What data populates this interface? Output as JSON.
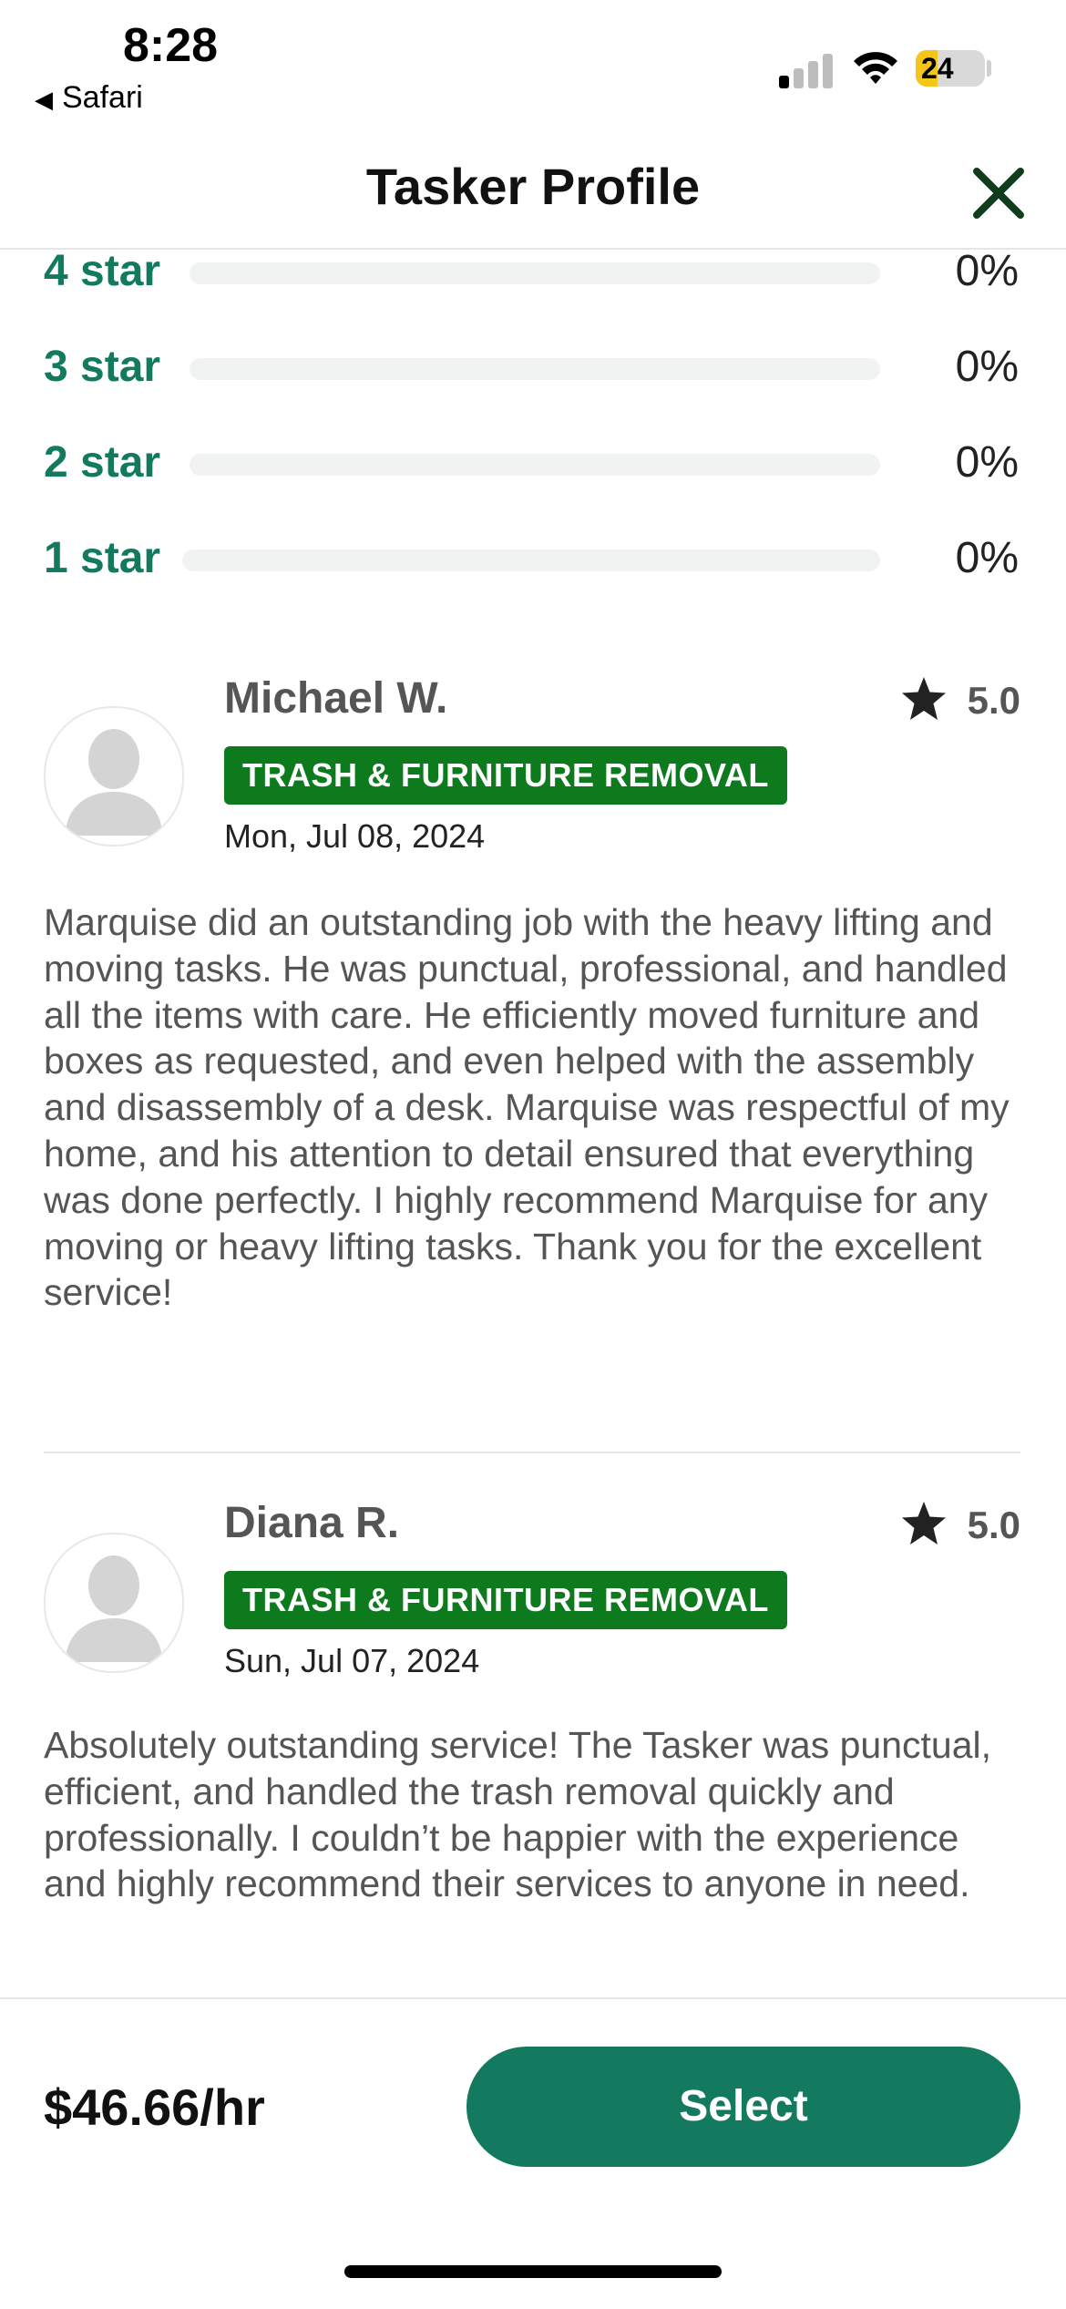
{
  "status_bar": {
    "time": "8:28",
    "back_app": "Safari",
    "battery": "24"
  },
  "header": {
    "title": "Tasker Profile"
  },
  "rating_breakdown": [
    {
      "label": "4 star",
      "percent": "0%",
      "value": 0
    },
    {
      "label": "3 star",
      "percent": "0%",
      "value": 0
    },
    {
      "label": "2 star",
      "percent": "0%",
      "value": 0
    },
    {
      "label": "1 star",
      "percent": "0%",
      "value": 0
    }
  ],
  "reviews": [
    {
      "name": "Michael W.",
      "rating": "5.0",
      "category": "TRASH & FURNITURE REMOVAL",
      "date": "Mon, Jul 08, 2024",
      "text": "Marquise did an outstanding job with the heavy lifting and moving tasks. He was punctual, professional, and handled all the items with care. He efficiently moved furniture and boxes as requested, and even helped with the assembly and disassembly of a desk. Marquise was respectful of my home, and his attention to detail ensured that everything was done perfectly. I highly recommend Marquise for any moving or heavy lifting tasks. Thank you for the excellent service!"
    },
    {
      "name": "Diana R.",
      "rating": "5.0",
      "category": "TRASH & FURNITURE REMOVAL",
      "date": "Sun, Jul 07, 2024",
      "text": "Absolutely outstanding service! The Tasker was punctual, efficient, and handled the trash removal quickly and professionally. I couldn’t be happier with the experience and highly recommend their services to anyone in need."
    }
  ],
  "footer": {
    "price": "$46.66/hr",
    "select_label": "Select"
  },
  "colors": {
    "accent": "#137a5f",
    "badge": "#0e7a1e"
  }
}
